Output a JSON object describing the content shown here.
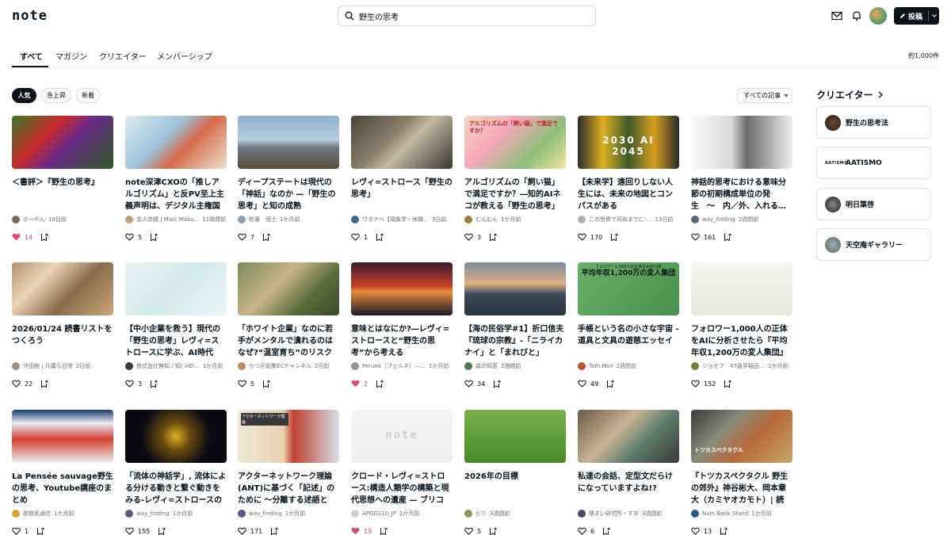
{
  "header": {
    "logo": "note",
    "search_value": "野生の思考",
    "post_label": "投稿"
  },
  "tabs": [
    {
      "label": "すべて",
      "active": true
    },
    {
      "label": "マガジン"
    },
    {
      "label": "クリエイター"
    },
    {
      "label": "メンバーシップ"
    }
  ],
  "result_count": "約1,000件",
  "chips": [
    "人気",
    "急上昇",
    "新着"
  ],
  "filter": "すべての記事",
  "colors": {
    "accent": "#08131a",
    "like": "#e0457b",
    "meta": "#6a6f73"
  },
  "cards": [
    {
      "title": "＜書評＞『野生の思考』",
      "author": "きーやん",
      "time": "10日前",
      "likes": "14",
      "liked": true
    },
    {
      "title": "note深津CXOの「推しアルゴリズム」と反PV至上主義声明は、デジタル主権国家…",
      "author": "志人奈銭 | Marc Masa…",
      "time": "11時間前",
      "likes": "5",
      "liked": false
    },
    {
      "title": "ディープステートは現代の「神話」なのか —「野生の思考」と知の成熟",
      "author": "佐藤　恒士",
      "time": "1か月前",
      "likes": "7",
      "liked": false
    },
    {
      "title": "レヴィ=ストロース「野生の思考」",
      "author": "ワタナベ【現象学・休職…",
      "time": "3日前",
      "likes": "1",
      "liked": false
    },
    {
      "title": "アルゴリズムの「飼い猫」で満足ですか？―知的AIネコが教える「野生の思考」奪…",
      "author": "むんむん",
      "time": "1か月前",
      "likes": "3",
      "liked": false
    },
    {
      "title": "【未来学】遠回りしない人生には、未来の地図とコンパスがある",
      "author": "この世界で死ぬまでに‐…",
      "time": "13日前",
      "likes": "170",
      "liked": false
    },
    {
      "title": "神話的思考における意味分節の初期構成単位の発生　〜　内／外、入れる…",
      "author": "way_finding",
      "time": "2週間前",
      "likes": "161",
      "liked": false
    },
    {
      "title": "2026/01/24 読書リストをつくろう",
      "author": "守田樹 | 凡庸な日常",
      "time": "2日前",
      "likes": "22",
      "liked": false
    },
    {
      "title": "【中小企業を救う】現代の「野生の思考」レヴィ=ストロースに学ぶ、AI時代の…",
      "author": "株式会社無知ノ知| AID…",
      "time": "1か月前",
      "likes": "3",
      "liked": false
    },
    {
      "title": "「ホワイト企業」なのに若手がメンタルで潰れるのはなぜ?“温室育ち”のリスクと…",
      "author": "かつ＠副業ECチャンネル",
      "time": "2日前",
      "likes": "5",
      "liked": false
    },
    {
      "title": "意味とはなにか?―レヴィ=ストロースと“野生の思考”から考える",
      "author": "Ferune（フェルネ）—…",
      "time": "1か月前",
      "likes": "2",
      "liked": true
    },
    {
      "title": "【海の民俗学#1】折口信夫『琉球の宗教』-「ニライカナイ」と「まれびと」",
      "author": "森の知恵",
      "time": "2週間前",
      "likes": "34",
      "liked": false
    },
    {
      "title": "手帳という名の小さな宇宙 - 道具と文具の遊慈エッセイ",
      "author": "Tom.Msn",
      "time": "2週間前",
      "likes": "49",
      "liked": false
    },
    {
      "title": "フォロワー1,000人の正体をAIに分析させたら『平均年収1,200万の変人集団』だっ…",
      "author": "ジョセフ　47歳早稲田…",
      "time": "1か月前",
      "likes": "152",
      "liked": false
    },
    {
      "title": "La Pensée sauvage野生の思考、Youtube講座のまとめ",
      "author": "部族民通信",
      "time": "1か月前",
      "likes": "1",
      "liked": false
    },
    {
      "title": "「流体の神話学」, 流体による分ける動きと繋ぐ動きをみる-レヴィ=ストロースの『…",
      "author": "way_finding",
      "time": "1か月前",
      "likes": "155",
      "liked": false
    },
    {
      "title": "アクターネットワーク理論(ANT)に基づく「記述」のために 〜分離する述語と結…",
      "author": "way_finding",
      "time": "1か月前",
      "likes": "171",
      "liked": false
    },
    {
      "title": "クロード・レヴィ=ストロース:構造人類学の構築と現代思想への遺産 — ブリコラ…",
      "author": "APGD110_JP",
      "time": "1か月前",
      "likes": "19",
      "liked": true
    },
    {
      "title": "2026年の目標",
      "author": "だり",
      "time": "3週間前",
      "likes": "5",
      "liked": false
    },
    {
      "title": "私達の会話、定型文だらけになっていますよね!?",
      "author": "棲まい研究所・すま",
      "time": "3週間前",
      "likes": "6",
      "liked": false
    },
    {
      "title": "『トツカスペクタクル 野生の郊外』神谷彬大、岡本章大（カミヤオカモト）| 読書…",
      "author": "Nuts Book Stand",
      "time": "1か月前",
      "likes": "13",
      "liked": false
    }
  ],
  "thumbs": [
    {
      "bg": "linear-gradient(135deg,#3d7a2a 0%,#c92a2a 35%,#6a2a8a 55%,#2d5a22 100%)"
    },
    {
      "bg": "linear-gradient(135deg,#dfe9f0 0%,#9cc3d9 40%,#d86a4a 60%,#e9e2d0 100%)"
    },
    {
      "bg": "linear-gradient(180deg,#8fb1cf 0%,#b8cde0 45%,#6c7a86 60%,#5b4a38 100%)"
    },
    {
      "bg": "linear-gradient(135deg,#4a4437 0%,#8a7e6a 40%,#c4b9a3 55%,#3a352c 100%)"
    },
    {
      "bg": "linear-gradient(135deg,#f4d6c0 0%,#f5a9b8 35%,#8cc07a 70%,#f5e3a0 100%)"
    },
    {
      "bg": "linear-gradient(90deg,#2a2a2a 0%,#e0b020 25%,#3a5a2a 50%,#d8a020 75%,#2a2a2a 100%)"
    },
    {
      "bg": "linear-gradient(90deg,#fafafa 0%,#d8d8d8 40%,#6a6a6a 55%,#f0f0f0 100%)"
    },
    {
      "bg": "linear-gradient(135deg,#b89070 0%,#e9d5b5 30%,#8a6a4a 60%,#c9a87a 100%)"
    },
    {
      "bg": "linear-gradient(135deg,#e8f3f3 0%,#d2eaea 50%,#eef6f6 100%)"
    },
    {
      "bg": "linear-gradient(135deg,#7a8a5a 0%,#c9b48a 40%,#5a6a3a 70%,#3a4a2a 100%)"
    },
    {
      "bg": "linear-gradient(180deg,#3a1a2a 0%,#c8402a 45%,#e88a3a 55%,#1a1a2a 100%)"
    },
    {
      "bg": "linear-gradient(180deg,#7a8aa0 0%,#e0b080 40%,#3a4a5a 60%,#2a3440 100%)"
    },
    {
      "bg": "linear-gradient(135deg,#6ab06a 0%,#5aa05a 50%,#4a904a 100%)"
    },
    {
      "bg": "linear-gradient(180deg,#f5f5f0 0%,#e8e8e0 100%)"
    },
    {
      "bg": "linear-gradient(180deg,#1a3a6a 0%,#e8ecf4 25%,#d04030 55%,#f0f0f0 100%)"
    },
    {
      "bg": "radial-gradient(circle at 50% 50%,#e0b020 0%,#6a4a10 25%,#0a0a14 60%)"
    },
    {
      "bg": "linear-gradient(90deg,#f0e8d8 0%,#e8d0b0 45%,#c04030 55%,#d8e0e8 100%)"
    },
    {
      "bg": "linear-gradient(180deg,#f4f4f4 0%,#f0f0f0 100%)"
    },
    {
      "bg": "linear-gradient(180deg,#7ab04a 0%,#5a9a3a 60%,#4a8a2a 100%)"
    },
    {
      "bg": "linear-gradient(135deg,#6a5a4a 0%,#c9b494 40%,#5a7a6a 65%,#3a3a3a 100%)"
    },
    {
      "bg": "linear-gradient(135deg,#3a3a3a 0%,#8a8a7a 35%,#b86a3a 60%,#c4a86a 100%)"
    }
  ],
  "thumb_text": {
    "t5": "アルゴリズムの「飼い猫」で満足ですか？",
    "t6": "2030 AI 2045",
    "t13": "平均年収1,200万の変人集団",
    "t13_top": "フォロワー1,000人の正体をAIが分析",
    "t17": "アクターネットワーク理論",
    "t18": "note",
    "t21": "トツカスペクタクル"
  },
  "creators_section": {
    "title": "クリエイター",
    "items": [
      {
        "name": "野生の思考法"
      },
      {
        "name": "AATISMO",
        "logo": "AATISMO"
      },
      {
        "name": "明日葉啓"
      },
      {
        "name": "天空庵ギャラリー"
      }
    ]
  }
}
